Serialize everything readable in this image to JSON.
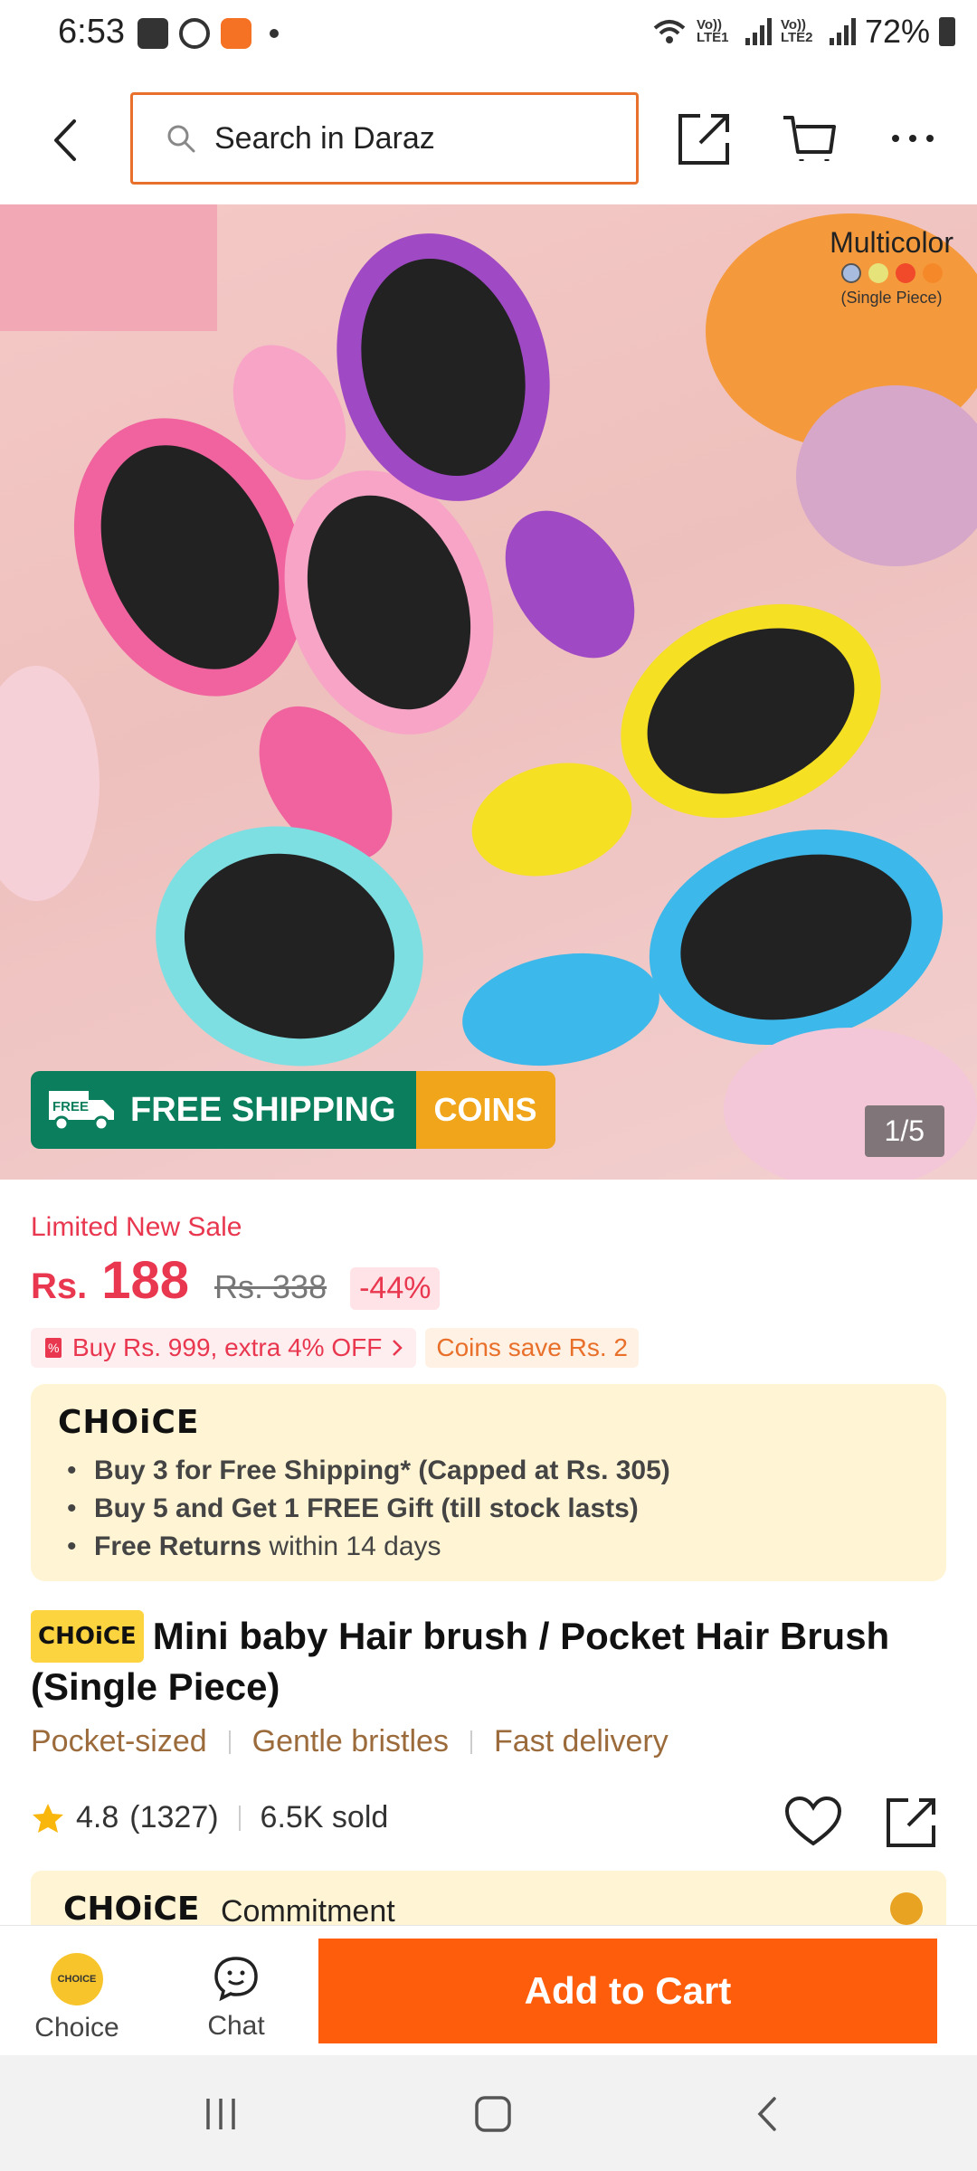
{
  "status_bar": {
    "time": "6:53",
    "lte1": "Vo)) LTE1",
    "lte2": "Vo)) LTE2",
    "battery": "72%"
  },
  "search": {
    "placeholder": "Search in Daraz"
  },
  "hero": {
    "variant_name": "Multicolor",
    "variant_note": "(Single Piece)",
    "swatch_colors": [
      "#a8bce0",
      "#e6e37a",
      "#f04a2a",
      "#f5892a"
    ],
    "free_shipping_tag": "FREE",
    "free_shipping_label": "FREE SHIPPING",
    "coins_label": "COINS",
    "image_index": "1/5"
  },
  "price": {
    "sale_title": "Limited New Sale",
    "currency": "Rs.",
    "current": "188",
    "original": "Rs. 338",
    "discount": "-44%"
  },
  "promos": {
    "bundle": "Buy Rs. 999, extra 4% OFF",
    "coins": "Coins save Rs. 2"
  },
  "choice_box": {
    "logo": "CHOiCE",
    "items": [
      {
        "bold": "Buy 3 for  Free Shipping* (Capped at Rs. 305)",
        "rest": ""
      },
      {
        "bold": "Buy 5 and Get 1 FREE Gift (till stock lasts)",
        "rest": ""
      },
      {
        "bold": "Free Returns",
        "rest": " within 14 days"
      }
    ]
  },
  "product": {
    "badge": "CHOiCE",
    "title": "Mini baby Hair brush / Pocket Hair Brush (Single Piece)",
    "tags": [
      "Pocket-sized",
      "Gentle bristles",
      "Fast delivery"
    ],
    "rating": "4.8",
    "reviews": "(1327)",
    "sold": "6.5K sold"
  },
  "commitment": {
    "logo": "CHOiCE",
    "label": "Commitment"
  },
  "action_bar": {
    "choice_icon_text": "CHOICE",
    "choice_label": "Choice",
    "chat_label": "Chat",
    "add_to_cart": "Add to Cart"
  },
  "colors": {
    "brand_orange": "#fe5d0b",
    "sale_red": "#e8374f",
    "choice_yellow": "#fff4d3"
  }
}
